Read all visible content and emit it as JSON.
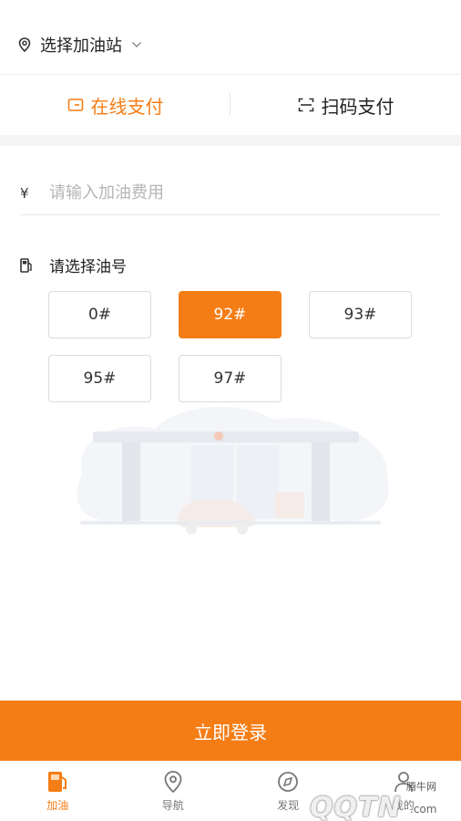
{
  "header": {
    "station_label": "选择加油站"
  },
  "tabs": [
    {
      "label": "在线支付",
      "icon": "wallet-icon",
      "active": true
    },
    {
      "label": "扫码支付",
      "icon": "scan-icon",
      "active": false
    }
  ],
  "fee": {
    "currency_symbol": "¥",
    "placeholder": "请输入加油费用"
  },
  "grades": {
    "title": "请选择油号",
    "options": [
      {
        "label": "0#",
        "selected": false
      },
      {
        "label": "92#",
        "selected": true
      },
      {
        "label": "93#",
        "selected": false
      },
      {
        "label": "95#",
        "selected": false
      },
      {
        "label": "97#",
        "selected": false
      }
    ]
  },
  "login": {
    "label": "立即登录"
  },
  "nav": [
    {
      "label": "加油",
      "icon": "fuel-pump-icon",
      "active": true
    },
    {
      "label": "导航",
      "icon": "location-pin-icon",
      "active": false
    },
    {
      "label": "发现",
      "icon": "discover-icon",
      "active": false
    },
    {
      "label": "我的",
      "icon": "user-icon",
      "active": false
    }
  ],
  "watermark": {
    "tag": "腾牛网",
    "text": "QQTN",
    "suffix": ".com"
  },
  "colors": {
    "accent": "#f57d16",
    "divider": "#ececec",
    "section_bg": "#f5f5f5",
    "placeholder": "#b5b5b5"
  }
}
